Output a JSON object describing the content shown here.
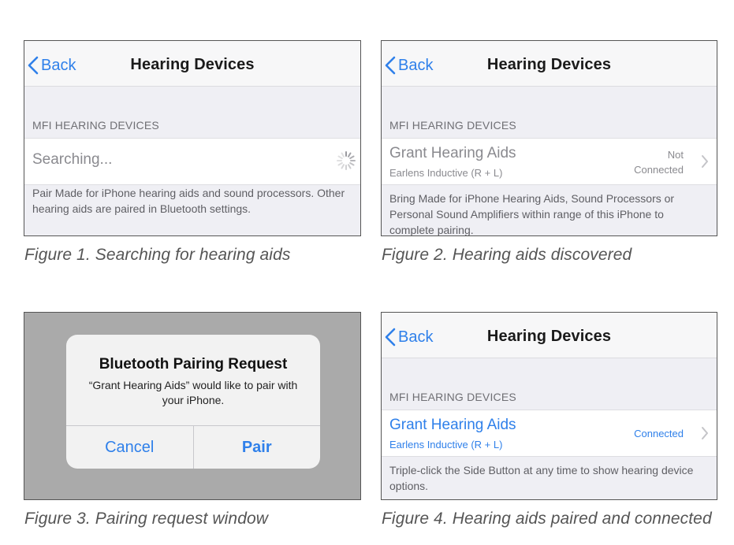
{
  "accent_color": "#2f80ea",
  "figures": [
    {
      "back_label": "Back",
      "title": "Hearing Devices",
      "section_header": "MFI HEARING DEVICES",
      "row_title": "Searching...",
      "footer": "Pair Made for iPhone hearing aids and sound processors. Other hearing aids are paired in Bluetooth settings.",
      "caption": "Figure 1. Searching for hearing aids"
    },
    {
      "back_label": "Back",
      "title": "Hearing Devices",
      "section_header": "MFI HEARING DEVICES",
      "row_title": "Grant Hearing Aids",
      "row_subtitle": "Earlens Inductive (R + L)",
      "status_line1": "Not",
      "status_line2": "Connected",
      "footer": "Bring Made for iPhone Hearing Aids, Sound Processors or Personal Sound Amplifiers within range of this iPhone to complete pairing.",
      "caption": "Figure 2. Hearing aids discovered"
    },
    {
      "alert_title": "Bluetooth Pairing Request",
      "alert_message": "“Grant Hearing Aids” would like to pair with your iPhone.",
      "cancel_label": "Cancel",
      "pair_label": "Pair",
      "caption": "Figure 3. Pairing request window"
    },
    {
      "back_label": "Back",
      "title": "Hearing Devices",
      "section_header": "MFI HEARING DEVICES",
      "row_title": "Grant Hearing Aids",
      "row_subtitle": "Earlens Inductive (R + L)",
      "status": "Connected",
      "footer": "Triple-click the Side Button at any time to show hearing device options.",
      "caption": "Figure 4. Hearing aids paired and connected"
    }
  ]
}
